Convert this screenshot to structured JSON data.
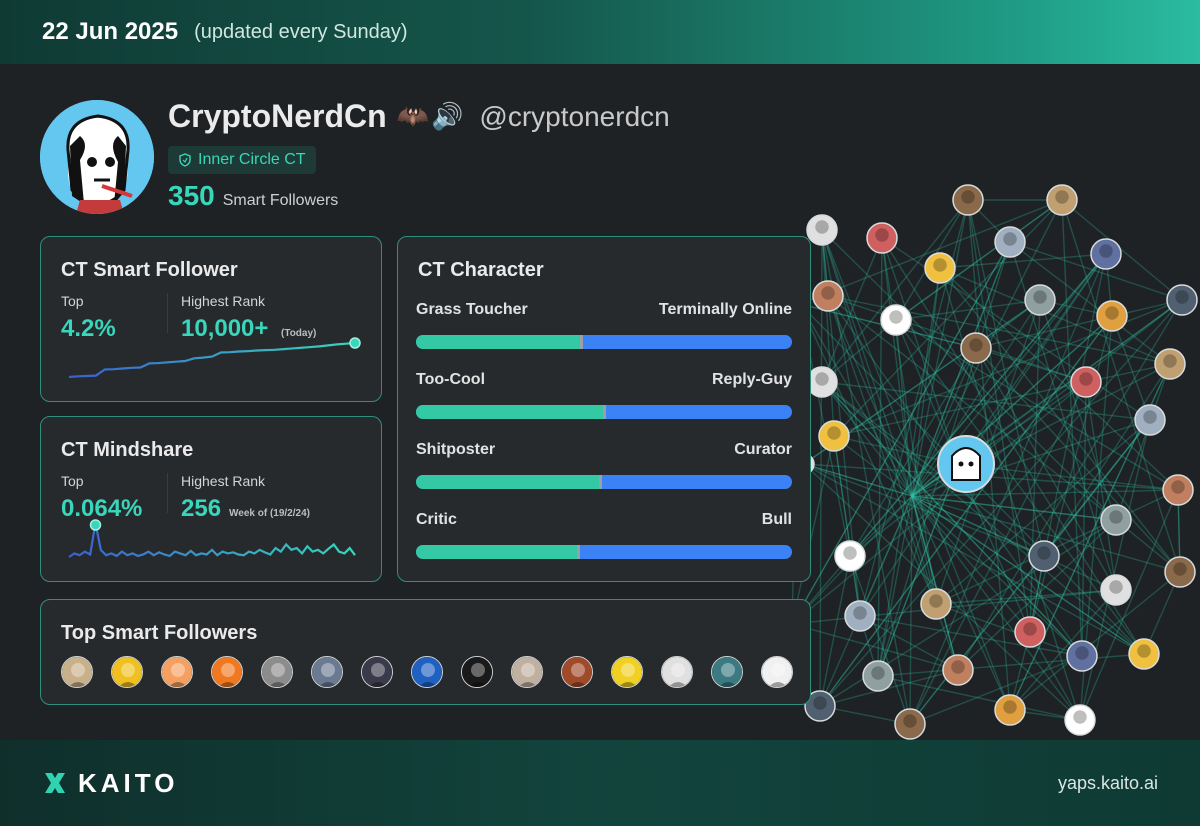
{
  "header": {
    "date": "22 Jun 2025",
    "update_note": "(updated every Sunday)"
  },
  "profile": {
    "name": "CryptoNerdCn",
    "emojis": [
      "🦇",
      "🔊"
    ],
    "handle": "@cryptonerdcn",
    "badge": "Inner Circle CT",
    "smart_followers_count": "350",
    "smart_followers_label": "Smart Followers"
  },
  "smart_follower_card": {
    "title": "CT Smart Follower",
    "top_label": "Top",
    "top_value": "4.2%",
    "rank_label": "Highest Rank",
    "rank_value": "10,000+",
    "rank_note": "(Today)",
    "trend": [
      0.0,
      0.02,
      0.03,
      0.04,
      0.22,
      0.23,
      0.25,
      0.27,
      0.28,
      0.4,
      0.41,
      0.43,
      0.45,
      0.47,
      0.55,
      0.57,
      0.6,
      0.72,
      0.73,
      0.75,
      0.76,
      0.78,
      0.79,
      0.8,
      0.82,
      0.84,
      0.86,
      0.88,
      0.9,
      0.93,
      0.96,
      0.98,
      1.0
    ]
  },
  "mindshare_card": {
    "title": "CT Mindshare",
    "top_label": "Top",
    "top_value": "0.064%",
    "rank_label": "Highest Rank",
    "rank_value": "256",
    "rank_note": "Week of (19/2/24)",
    "trend": [
      0.05,
      0.15,
      0.1,
      0.2,
      0.12,
      1.0,
      0.25,
      0.1,
      0.15,
      0.08,
      0.2,
      0.1,
      0.15,
      0.08,
      0.12,
      0.2,
      0.1,
      0.18,
      0.12,
      0.08,
      0.2,
      0.15,
      0.1,
      0.22,
      0.1,
      0.15,
      0.12,
      0.25,
      0.1,
      0.2,
      0.15,
      0.18,
      0.12,
      0.1,
      0.2,
      0.15,
      0.25,
      0.18,
      0.12,
      0.3,
      0.2,
      0.4,
      0.25,
      0.3,
      0.15,
      0.35,
      0.2,
      0.25,
      0.15,
      0.28,
      0.4,
      0.2,
      0.15,
      0.3,
      0.1
    ]
  },
  "character_card": {
    "title": "CT Character",
    "traits": [
      {
        "left": "Grass Toucher",
        "right": "Terminally Online",
        "value": 0.44
      },
      {
        "left": "Too-Cool",
        "right": "Reply-Guy",
        "value": 0.5
      },
      {
        "left": "Shitposter",
        "right": "Curator",
        "value": 0.49
      },
      {
        "left": "Critic",
        "right": "Bull",
        "value": 0.43
      }
    ]
  },
  "top_followers": {
    "title": "Top Smart Followers",
    "colors": [
      "#c8b08a",
      "#f0c020",
      "#f5a060",
      "#f07820",
      "#8c8c8c",
      "#6a7a90",
      "#3a3a4a",
      "#2060c0",
      "#1a1a1a",
      "#c0b0a0",
      "#a04a2a",
      "#f0d020",
      "#e0e0e0",
      "#3a7a80",
      "#f0f0f0"
    ]
  },
  "footer": {
    "brand": "KAITO",
    "site": "yaps.kaito.ai"
  },
  "theme": {
    "accent": "#38d6ba",
    "blue": "#3b82f6",
    "card_border": "#2f8f7f"
  }
}
